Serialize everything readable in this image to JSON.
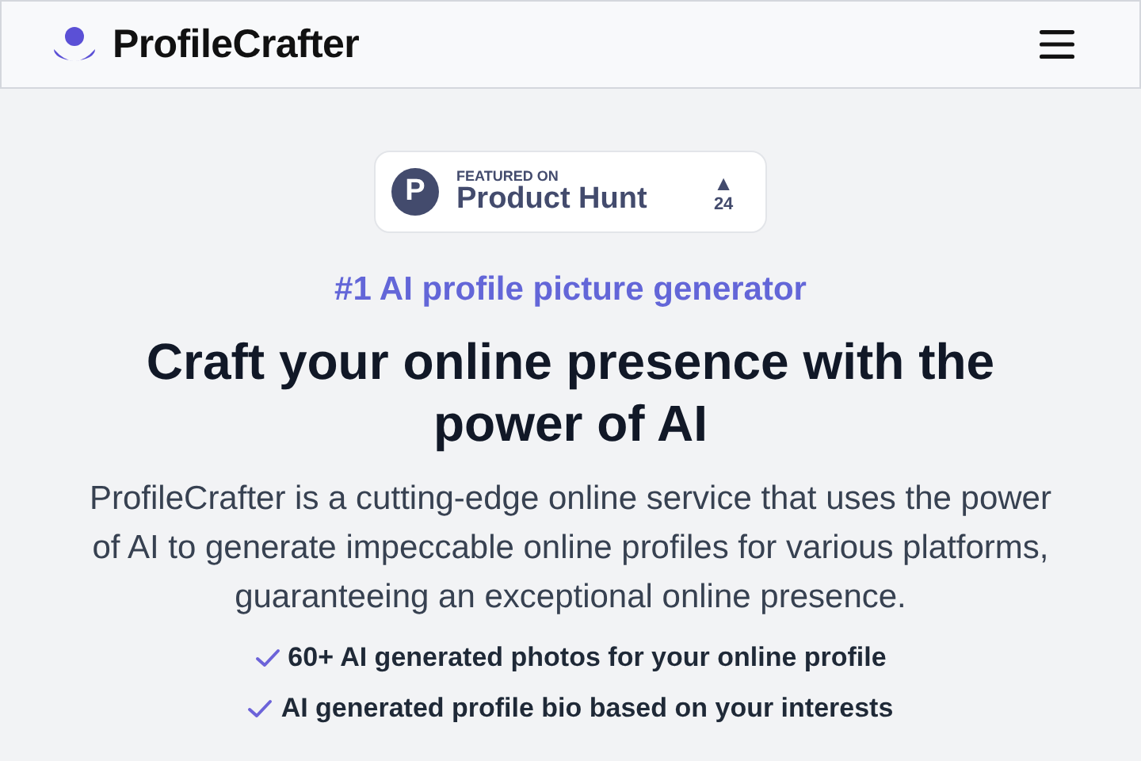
{
  "header": {
    "brand": "ProfileCrafter"
  },
  "badge": {
    "logo_letter": "P",
    "caption": "FEATURED ON",
    "name": "Product Hunt",
    "upvote_icon": "▲",
    "votes": "24"
  },
  "hero": {
    "eyebrow": "#1 AI profile picture generator",
    "title": "Craft your online presence with the power of AI",
    "description": "ProfileCrafter is a cutting-edge online service that uses the power of AI to generate impeccable online profiles for various platforms, guaranteeing an exceptional online presence."
  },
  "features": [
    {
      "text": "60+ AI generated photos for your online profile"
    },
    {
      "text": "AI generated profile bio based on your interests"
    }
  ]
}
